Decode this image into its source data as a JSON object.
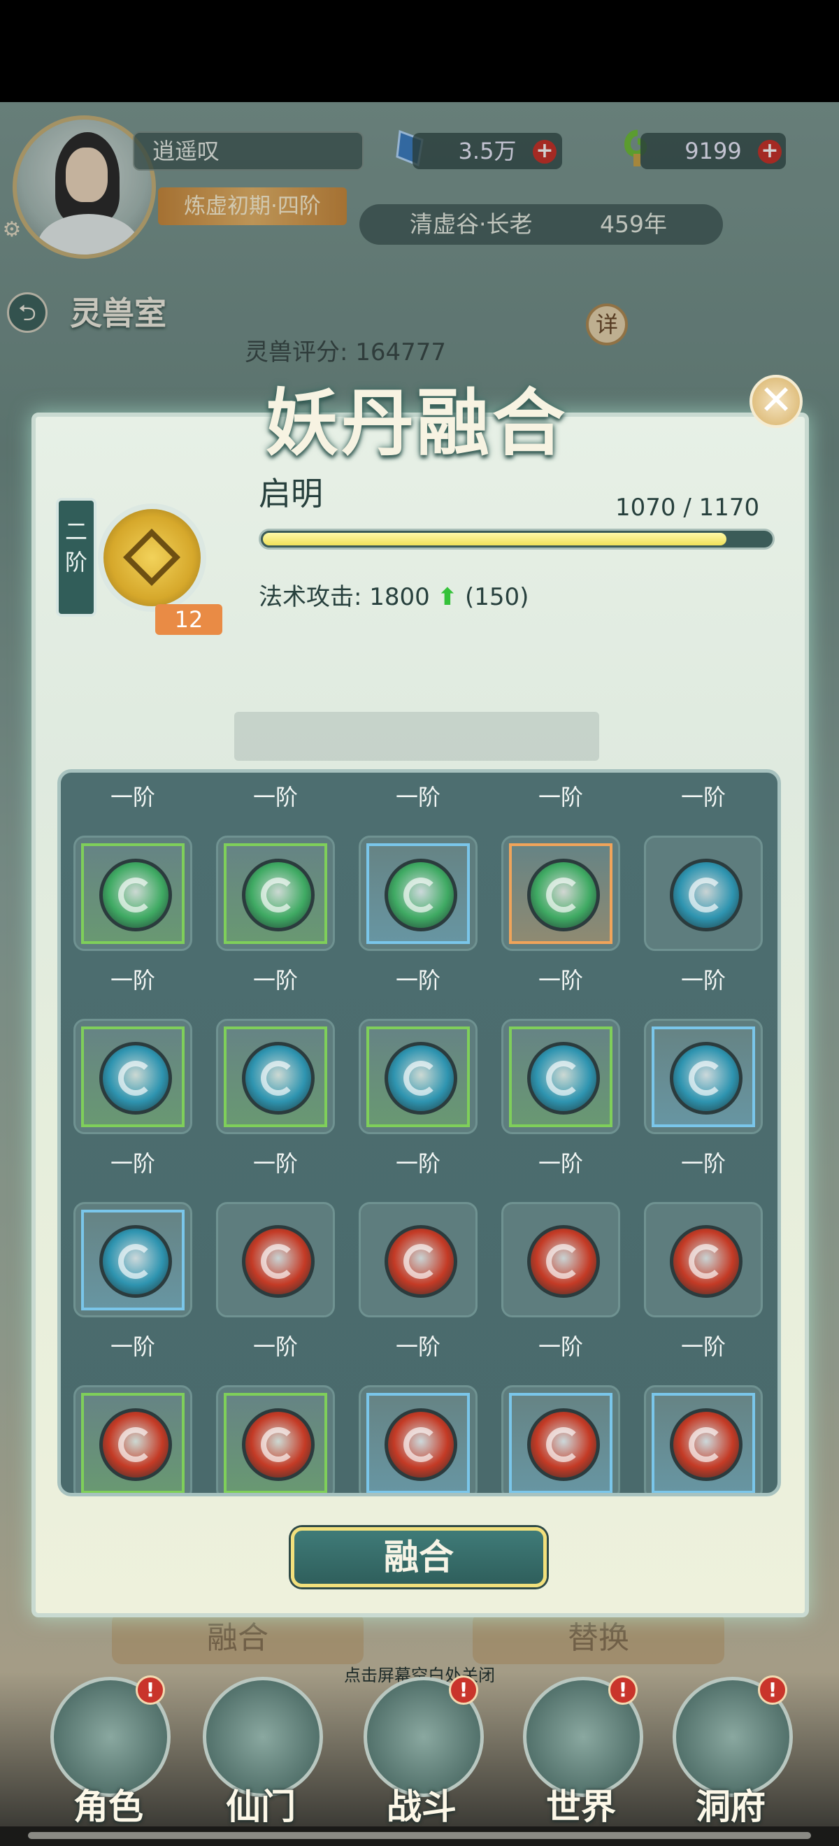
{
  "header": {
    "player_name": "逍遥叹",
    "rank": "炼虚初期·四阶",
    "sect": "清虚谷·长老",
    "age": "459年",
    "currency_1": "3.5万",
    "currency_2": "9199",
    "plus": "+"
  },
  "room": {
    "title": "灵兽室",
    "score": "灵兽评分: 164777",
    "detail_label": "详"
  },
  "modal": {
    "title": "妖丹融合",
    "close": "✕",
    "core": {
      "tier": "二阶",
      "name": "启明",
      "level": "12",
      "progress_text": "1070 / 1170",
      "progress_value": 1070,
      "progress_max": 1170,
      "stat_label": "法术攻击:",
      "stat_value": "1800",
      "stat_arrow": "⬆",
      "stat_bonus": "(150)"
    },
    "grid": [
      {
        "label": "一阶",
        "element": "wood",
        "frame": "green"
      },
      {
        "label": "一阶",
        "element": "wood",
        "frame": "green"
      },
      {
        "label": "一阶",
        "element": "wood",
        "frame": "blue"
      },
      {
        "label": "一阶",
        "element": "wood",
        "frame": "orange"
      },
      {
        "label": "一阶",
        "element": "water",
        "frame": "none"
      },
      {
        "label": "一阶",
        "element": "water",
        "frame": "green"
      },
      {
        "label": "一阶",
        "element": "water",
        "frame": "green"
      },
      {
        "label": "一阶",
        "element": "water",
        "frame": "green"
      },
      {
        "label": "一阶",
        "element": "water",
        "frame": "green"
      },
      {
        "label": "一阶",
        "element": "water",
        "frame": "blue"
      },
      {
        "label": "一阶",
        "element": "water",
        "frame": "blue"
      },
      {
        "label": "一阶",
        "element": "fire",
        "frame": "none"
      },
      {
        "label": "一阶",
        "element": "fire",
        "frame": "none"
      },
      {
        "label": "一阶",
        "element": "fire",
        "frame": "none"
      },
      {
        "label": "一阶",
        "element": "fire",
        "frame": "none"
      },
      {
        "label": "一阶",
        "element": "fire",
        "frame": "green"
      },
      {
        "label": "一阶",
        "element": "fire",
        "frame": "green"
      },
      {
        "label": "一阶",
        "element": "fire",
        "frame": "blue"
      },
      {
        "label": "一阶",
        "element": "fire",
        "frame": "blue"
      },
      {
        "label": "一阶",
        "element": "fire",
        "frame": "blue"
      }
    ],
    "fuse_button": "融合"
  },
  "hint": "点击屏幕空白处关闭",
  "background_buttons": [
    "融合",
    "替换"
  ],
  "nav": [
    {
      "label": "角色",
      "alert": "!"
    },
    {
      "label": "仙门",
      "alert": ""
    },
    {
      "label": "战斗",
      "alert": "!"
    },
    {
      "label": "世界",
      "alert": "!"
    },
    {
      "label": "洞府",
      "alert": "!"
    }
  ],
  "colors": {
    "frame_green": "#7fcf5a",
    "frame_blue": "#7ac6ea",
    "frame_orange": "#f0a45a",
    "wood": "#3faa63",
    "water": "#2e94b0",
    "fire": "#c43a25"
  }
}
